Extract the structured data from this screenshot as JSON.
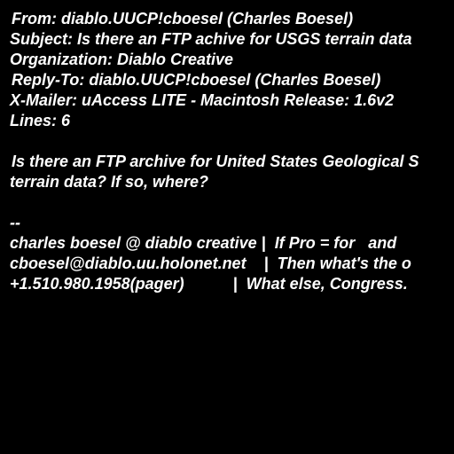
{
  "colors": {
    "background": "#000000",
    "text": "#ffffff"
  },
  "headers": {
    "from": "From: diablo.UUCP!cboesel (Charles Boesel)",
    "subject": "Subject: Is there an FTP achive for USGS terrain data",
    "organization": "Organization: Diablo Creative",
    "reply_to": "Reply-To: diablo.UUCP!cboesel (Charles Boesel)",
    "x_mailer": "X-Mailer: uAccess LITE - Macintosh Release: 1.6v2",
    "lines": "Lines: 6"
  },
  "body": {
    "line1": "Is there an FTP archive for United States Geological S",
    "line2": "terrain data? If so, where?"
  },
  "signature": {
    "separator": "--",
    "line1": "charles boesel @ diablo creative |  If Pro = for   and",
    "line2": "cboesel@diablo.uu.holonet.net    |  Then what's the o",
    "line3": "+1.510.980.1958(pager)           |  What else, Congress."
  }
}
